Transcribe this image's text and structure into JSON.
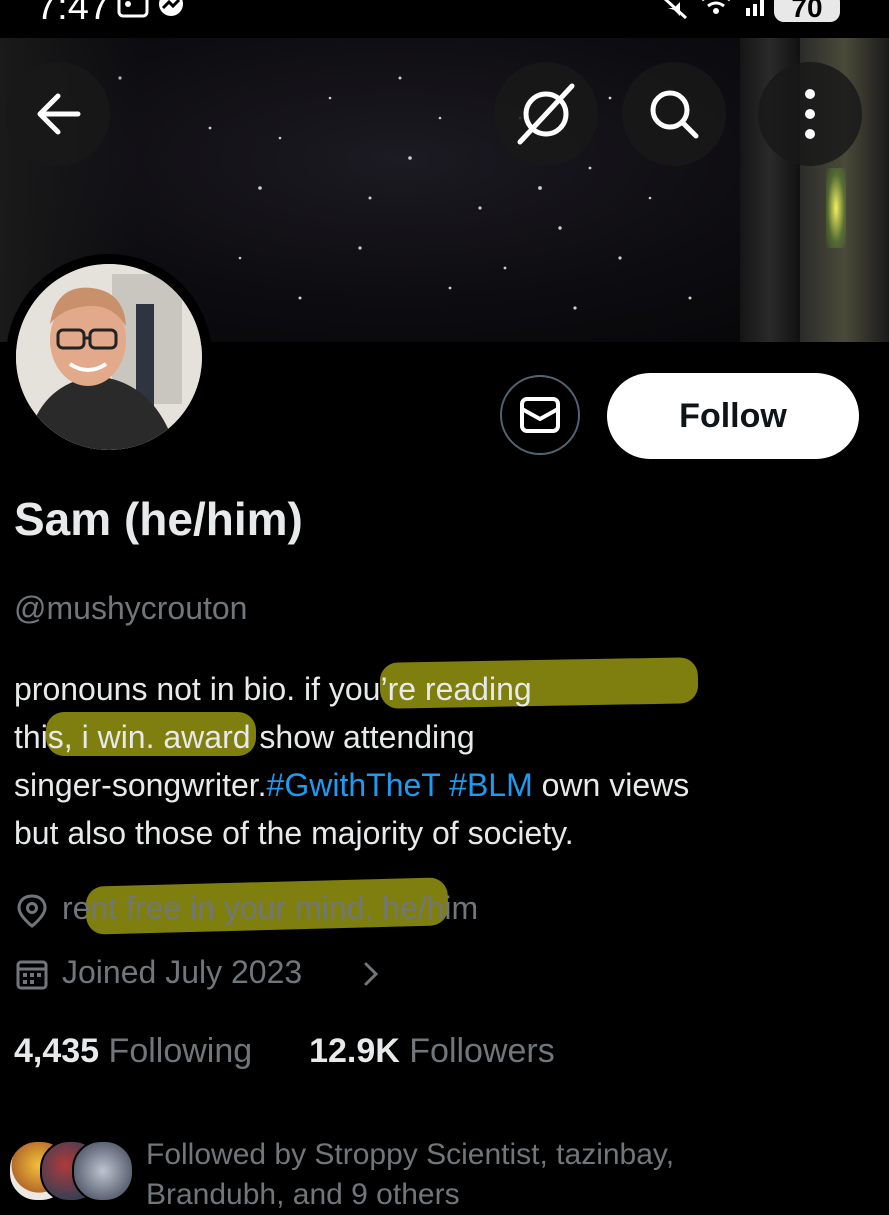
{
  "status_bar": {
    "time": "7:47",
    "battery": "70"
  },
  "header": {
    "back_icon": "arrow-left-icon",
    "grok_icon": "slash-circle-icon",
    "search_icon": "search-icon",
    "more_icon": "more-vertical-icon"
  },
  "profile": {
    "name": "Sam (he/him)",
    "handle": "@mushycrouton",
    "follow_label": "Follow",
    "message_icon": "envelope-icon"
  },
  "bio": {
    "line1": "pronouns not in bio. if you’re reading",
    "line2": "this, i win. award show attending",
    "line3_pre": "singer-songwriter.",
    "line3_tag1": "#GwithTheT",
    "line3_tag2": "#BLM",
    "line3_post": " own views",
    "line4": "but also those of the majority of society."
  },
  "meta": {
    "location": "rent free in your mind. he/him",
    "joined": "Joined July 2023"
  },
  "stats": {
    "following_count": "4,435",
    "following_label": "Following",
    "followers_count": "12.9K",
    "followers_label": "Followers"
  },
  "followed_by": {
    "line1": "Followed by Stroppy Scientist, tazinbay,",
    "line2": "Brandubh, and 9 others"
  },
  "colors": {
    "background": "#000000",
    "text_primary": "#e7e9ea",
    "text_secondary": "#71767b",
    "link": "#1d9bf0",
    "highlight": "#aaaa14"
  }
}
